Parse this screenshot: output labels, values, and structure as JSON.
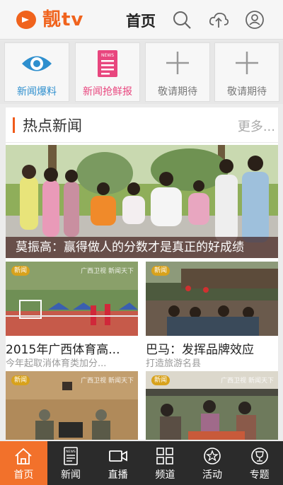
{
  "header": {
    "logo_text": "靓tv",
    "title": "首页",
    "icons": [
      "search-icon",
      "cloud-upload-icon",
      "user-icon"
    ]
  },
  "tiles": [
    {
      "label": "新闻爆料",
      "icon": "eye-icon"
    },
    {
      "label": "新闻抢鲜报",
      "icon": "news-document-icon",
      "icon_text": "NEWS"
    },
    {
      "label": "敬请期待",
      "icon": "plus-icon"
    },
    {
      "label": "敬请期待",
      "icon": "plus-icon"
    }
  ],
  "hot_news": {
    "title": "热点新闻",
    "more": "更多...",
    "hero": {
      "caption": "莫振高：赢得做人的分数才是真正的好成绩"
    },
    "cards": [
      {
        "title": "2015年广西体育高...",
        "subtitle": "今年起取消体育类加分...",
        "badge": "新闻",
        "watermark": "广西卫视 新闻天下"
      },
      {
        "title": "巴马：发挥品牌效应",
        "subtitle": "打造旅游名县",
        "badge": "新闻",
        "watermark": ""
      },
      {
        "title": "",
        "subtitle": "",
        "badge": "新闻",
        "watermark": "广西卫视 新闻天下"
      },
      {
        "title": "",
        "subtitle": "",
        "badge": "新闻",
        "watermark": "广西卫视 新闻天下"
      }
    ]
  },
  "nav": {
    "items": [
      {
        "label": "首页",
        "icon": "home-icon",
        "active": true
      },
      {
        "label": "新闻",
        "icon": "news-icon",
        "icon_text": "NEWS"
      },
      {
        "label": "直播",
        "icon": "video-camera-icon"
      },
      {
        "label": "频道",
        "icon": "grid-icon"
      },
      {
        "label": "活动",
        "icon": "star-badge-icon"
      },
      {
        "label": "专题",
        "icon": "trophy-icon"
      }
    ]
  },
  "colors": {
    "accent": "#f2712b",
    "blue": "#2e8fce",
    "pink": "#e8467e",
    "nav_bg": "#2b2b2b"
  }
}
